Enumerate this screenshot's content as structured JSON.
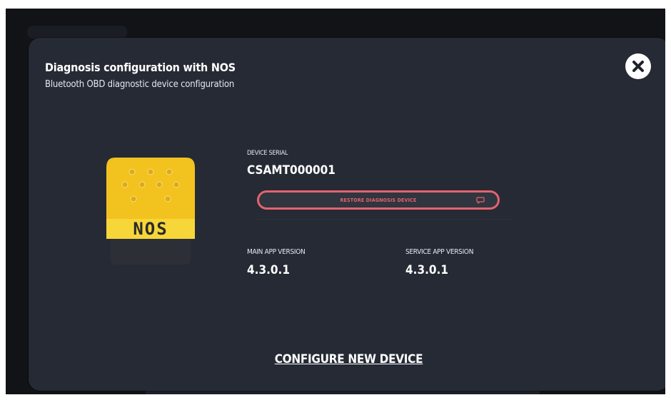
{
  "modal": {
    "title": "Diagnosis configuration with NOS",
    "subtitle": "Bluetooth OBD diagnostic device configuration"
  },
  "device": {
    "brand_text": "NOS",
    "serial_label": "DEVICE SERIAL",
    "serial_value": "CSAMT000001"
  },
  "restore_button": {
    "label": "RESTORE DIAGNOSIS DEVICE"
  },
  "versions": {
    "main_label": "MAIN APP VERSION",
    "main_value": "4.3.0.1",
    "service_label": "SERVICE APP VERSION",
    "service_value": "4.3.0.1"
  },
  "configure_link": "CONFIGURE NEW DEVICE",
  "icons": {
    "close": "close-icon",
    "restore": "chat-bubble-icon",
    "device": "obd-dongle-icon"
  },
  "colors": {
    "modal_bg": "#252a35",
    "accent_red": "#e2646f",
    "device_yellow": "#f2c21f"
  }
}
